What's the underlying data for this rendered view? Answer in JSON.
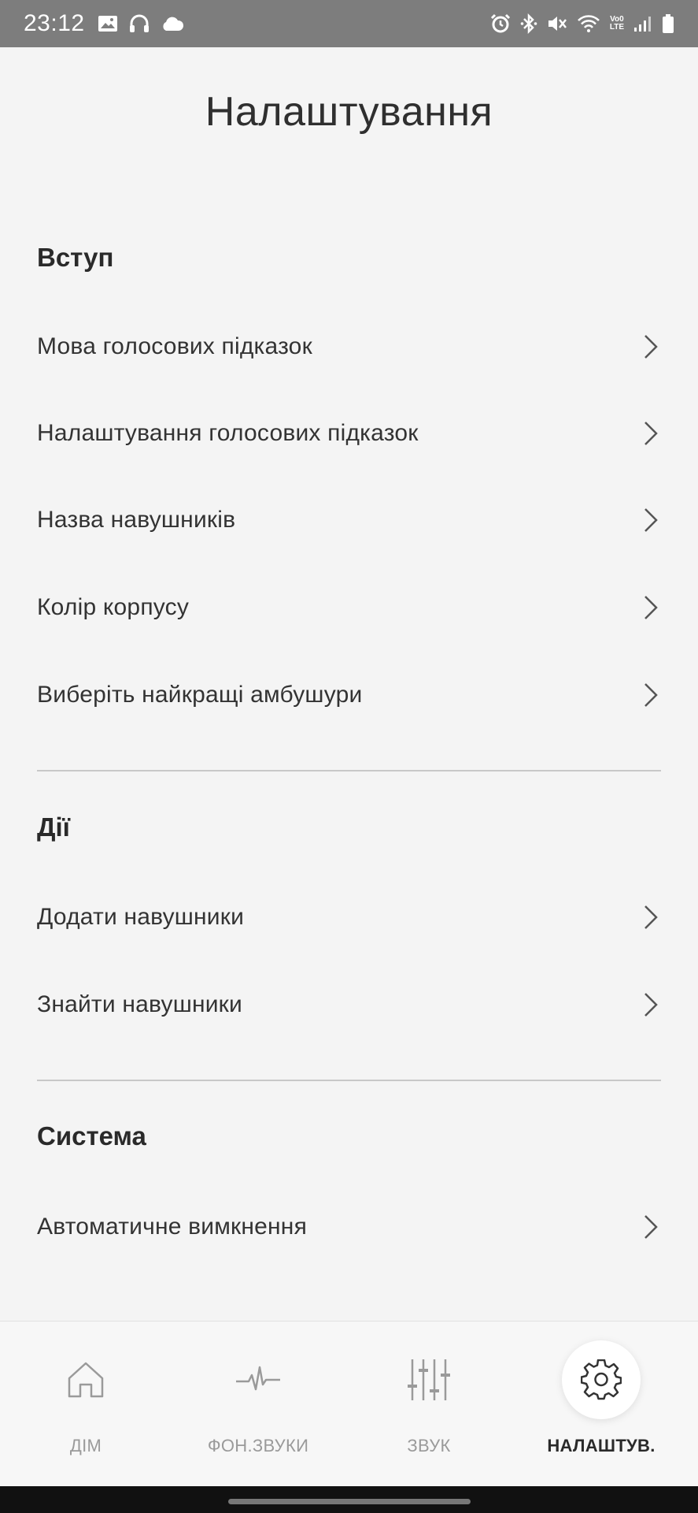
{
  "status_bar": {
    "time": "23:12",
    "left_icons": [
      "gallery-icon",
      "headphones-icon",
      "cloud-icon"
    ],
    "right_icons": [
      "alarm-icon",
      "bluetooth-icon",
      "mute-icon",
      "wifi-icon",
      "volte-icon",
      "signal-icon",
      "battery-icon"
    ],
    "volte_top": "Vo0",
    "volte_bottom": "LTE"
  },
  "page": {
    "title": "Налаштування"
  },
  "sections": {
    "intro": {
      "heading": "Вступ",
      "items": [
        {
          "label": "Мова голосових підказок"
        },
        {
          "label": "Налаштування голосових підказок"
        },
        {
          "label": "Назва навушників"
        },
        {
          "label": "Колір корпусу"
        },
        {
          "label": "Виберіть найкращі амбушури"
        }
      ]
    },
    "actions": {
      "heading": "Дії",
      "items": [
        {
          "label": "Додати навушники"
        },
        {
          "label": "Знайти навушники"
        }
      ]
    },
    "system": {
      "heading": "Система",
      "items": [
        {
          "label": "Автоматичне вимкнення"
        }
      ]
    }
  },
  "bottom_nav": {
    "items": [
      {
        "label": "ДІМ",
        "icon": "home-icon"
      },
      {
        "label": "ФОН.ЗВУКИ",
        "icon": "waveform-icon"
      },
      {
        "label": "ЗВУК",
        "icon": "equalizer-icon"
      },
      {
        "label": "НАЛАШТУВ.",
        "icon": "gear-icon",
        "active": true
      }
    ]
  },
  "colors": {
    "status_bar": "#7d7d7d",
    "background": "#f4f4f4",
    "text": "#333333",
    "inactive_nav": "#9a9a9a",
    "active_nav": "#2a2a2a"
  }
}
